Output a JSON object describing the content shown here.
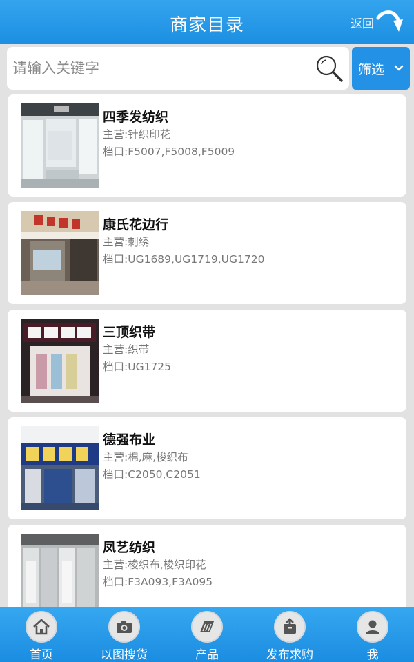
{
  "header": {
    "title": "商家目录",
    "back_label": "返回"
  },
  "search": {
    "placeholder": "请输入关键字",
    "value": "",
    "filter_label": "筛选"
  },
  "merchants": [
    {
      "name": "四季发纺织",
      "business": "主营:针织印花",
      "stall": "档口:F5007,F5008,F5009",
      "icon": "store-photo"
    },
    {
      "name": "康氏花边行",
      "business": "主营:刺绣",
      "stall": "档口:UG1689,UG1719,UG1720",
      "icon": "store-photo"
    },
    {
      "name": "三顶织带",
      "business": "主营:织带",
      "stall": "档口:UG1725",
      "icon": "store-photo"
    },
    {
      "name": "德强布业",
      "business": "主营:棉,麻,梭织布",
      "stall": "档口:C2050,C2051",
      "icon": "store-photo"
    },
    {
      "name": "凤艺纺织",
      "business": "主营:梭织布,梭织印花",
      "stall": "档口:F3A093,F3A095",
      "icon": "store-photo"
    }
  ],
  "tabs": [
    {
      "label": "首页",
      "icon": "home-icon"
    },
    {
      "label": "以图搜货",
      "icon": "camera-icon"
    },
    {
      "label": "产品",
      "icon": "fabric-icon"
    },
    {
      "label": "发布求购",
      "icon": "publish-icon"
    },
    {
      "label": "我",
      "icon": "user-icon"
    }
  ],
  "colors": {
    "primary": "#1c8fe2",
    "filter_button": "#2392e6",
    "background": "#e2e2e2"
  }
}
